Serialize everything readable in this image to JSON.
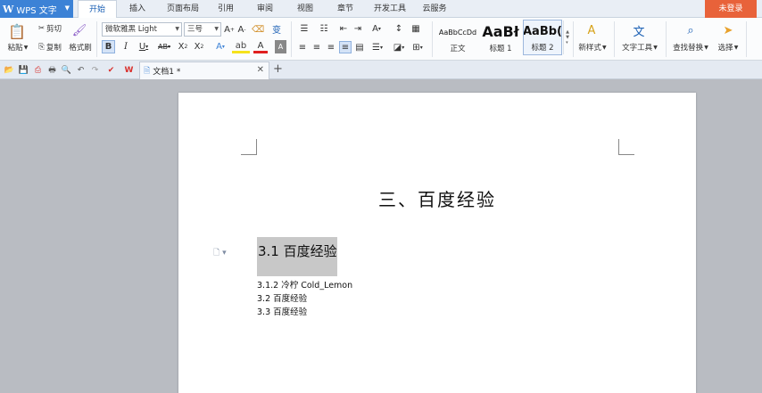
{
  "app": {
    "name": "WPS 文字"
  },
  "menu": {
    "tabs": [
      "开始",
      "插入",
      "页面布局",
      "引用",
      "审阅",
      "视图",
      "章节",
      "开发工具",
      "云服务"
    ],
    "active_tab": "开始",
    "login_label": "未登录"
  },
  "ribbon": {
    "paste": "粘贴",
    "cut": "剪切",
    "copy": "复制",
    "format_painter": "格式刷",
    "font_name": "微软雅黑 Light",
    "font_size": "三号",
    "styles": [
      {
        "sample": "AaBbCcDd",
        "label": "正文"
      },
      {
        "sample": "AaBł",
        "label": "标题 1"
      },
      {
        "sample": "AaBb(",
        "label": "标题 2"
      }
    ],
    "new_style": "新样式",
    "text_tools": "文字工具",
    "find_replace": "查找替换",
    "select": "选择"
  },
  "document_tab": {
    "name": "文档1 *"
  },
  "document": {
    "title": "三、百度经验",
    "heading": "3.1 百度经验",
    "paragraphs": [
      "3.1.2 冷柠 Cold_Lemon",
      "3.2 百度经验",
      "3.3 百度经验"
    ]
  }
}
